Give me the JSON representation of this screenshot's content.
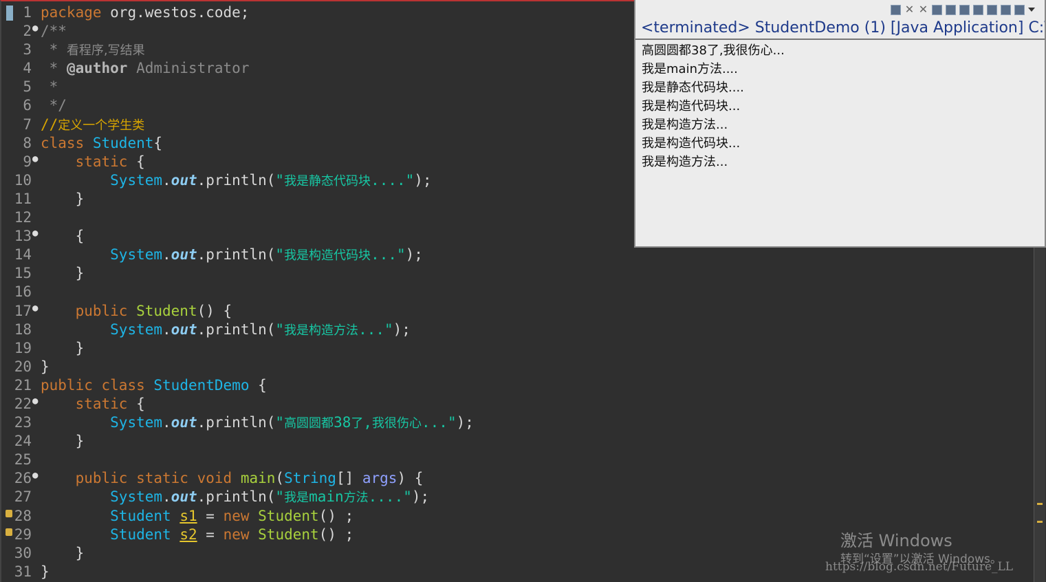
{
  "editor": {
    "lines": [
      {
        "n": "1",
        "fold": false,
        "warn": false,
        "html": "<span class=\"kw\">package</span> org.westos.code;"
      },
      {
        "n": "2",
        "fold": true,
        "warn": false,
        "html": "<span class=\"com\">/**</span>"
      },
      {
        "n": "3",
        "fold": false,
        "warn": false,
        "html": "<span class=\"com\"> * <span class=\"cn\">看程序,写结果</span></span>"
      },
      {
        "n": "4",
        "fold": false,
        "warn": false,
        "html": "<span class=\"com\"> * <span class=\"ann\">@author</span> Administrator</span>"
      },
      {
        "n": "5",
        "fold": false,
        "warn": false,
        "html": "<span class=\"com\"> *</span>"
      },
      {
        "n": "6",
        "fold": false,
        "warn": false,
        "html": "<span class=\"com\"> */</span>"
      },
      {
        "n": "7",
        "fold": false,
        "warn": false,
        "html": "<span class=\"lc\">//<span class=\"cn\">定义一个学生类</span></span>"
      },
      {
        "n": "8",
        "fold": false,
        "warn": false,
        "html": "<span class=\"kw\">class</span> <span class=\"cls\">Student</span>{"
      },
      {
        "n": "9",
        "fold": true,
        "warn": false,
        "html": "    <span class=\"kw\">static</span> {"
      },
      {
        "n": "10",
        "fold": false,
        "warn": false,
        "html": "        <span class=\"ty\">System</span>.<span class=\"fld\">out</span>.println(<span class=\"str\">\"<span class=\"cn\">我是静态代码块</span>....\"</span>);"
      },
      {
        "n": "11",
        "fold": false,
        "warn": false,
        "html": "    }"
      },
      {
        "n": "12",
        "fold": false,
        "warn": false,
        "html": ""
      },
      {
        "n": "13",
        "fold": true,
        "warn": false,
        "html": "    {"
      },
      {
        "n": "14",
        "fold": false,
        "warn": false,
        "html": "        <span class=\"ty\">System</span>.<span class=\"fld\">out</span>.println(<span class=\"str\">\"<span class=\"cn\">我是构造代码块</span>...\"</span>);"
      },
      {
        "n": "15",
        "fold": false,
        "warn": false,
        "html": "    }"
      },
      {
        "n": "16",
        "fold": false,
        "warn": false,
        "html": ""
      },
      {
        "n": "17",
        "fold": true,
        "warn": false,
        "html": "    <span class=\"kw\">public</span> <span class=\"fn\">Student</span>() {"
      },
      {
        "n": "18",
        "fold": false,
        "warn": false,
        "html": "        <span class=\"ty\">System</span>.<span class=\"fld\">out</span>.println(<span class=\"str\">\"<span class=\"cn\">我是构造方法</span>...\"</span>);"
      },
      {
        "n": "19",
        "fold": false,
        "warn": false,
        "html": "    }"
      },
      {
        "n": "20",
        "fold": false,
        "warn": false,
        "html": "}"
      },
      {
        "n": "21",
        "fold": false,
        "warn": false,
        "html": "<span class=\"kw\">public</span> <span class=\"kw\">class</span> <span class=\"cls\">StudentDemo</span> {"
      },
      {
        "n": "22",
        "fold": true,
        "warn": false,
        "html": "    <span class=\"kw\">static</span> {"
      },
      {
        "n": "23",
        "fold": false,
        "warn": false,
        "html": "        <span class=\"ty\">System</span>.<span class=\"fld\">out</span>.println(<span class=\"str\">\"<span class=\"cn\">高圆圆都</span>38<span class=\"cn\">了</span>,<span class=\"cn\">我很伤心</span>...\"</span>);"
      },
      {
        "n": "24",
        "fold": false,
        "warn": false,
        "html": "    }"
      },
      {
        "n": "25",
        "fold": false,
        "warn": false,
        "html": ""
      },
      {
        "n": "26",
        "fold": true,
        "warn": false,
        "html": "    <span class=\"kw\">public</span> <span class=\"kw\">static</span> <span class=\"kw\">void</span> <span class=\"fn\">main</span>(<span class=\"ty\">String</span>[] <span class=\"par\">args</span>) {"
      },
      {
        "n": "27",
        "fold": false,
        "warn": false,
        "html": "        <span class=\"ty\">System</span>.<span class=\"fld\">out</span>.println(<span class=\"str\">\"<span class=\"cn\">我是</span>main<span class=\"cn\">方法</span>....\"</span>);"
      },
      {
        "n": "28",
        "fold": false,
        "warn": true,
        "html": "        <span class=\"ty\">Student</span> <span class=\"var\">s1</span> = <span class=\"kw\">new</span> <span class=\"fn\">Student</span>() ;"
      },
      {
        "n": "29",
        "fold": false,
        "warn": true,
        "html": "        <span class=\"ty\">Student</span> <span class=\"var\">s2</span> = <span class=\"kw\">new</span> <span class=\"fn\">Student</span>() ;"
      },
      {
        "n": "30",
        "fold": false,
        "warn": false,
        "html": "    }"
      },
      {
        "n": "31",
        "fold": false,
        "warn": false,
        "html": "}"
      }
    ]
  },
  "console": {
    "title": "<terminated> StudentDemo (1) [Java Application] C:\\",
    "output": [
      "高圆圆都38了,我很伤心...",
      "我是main方法....",
      "我是静态代码块....",
      "我是构造代码块...",
      "我是构造方法...",
      "我是构造代码块...",
      "我是构造方法..."
    ],
    "toolbar_icons": [
      "terminate-icon",
      "remove-launch-icon",
      "remove-all-icon",
      "scroll-lock-icon",
      "word-wrap-icon",
      "show-on-output-icon",
      "show-on-error-icon",
      "pin-console-icon",
      "display-console-icon",
      "open-console-icon",
      "view-menu-icon"
    ]
  },
  "watermark": {
    "title": "激活 Windows",
    "subtitle": "转到“设置”以激活 Windows。",
    "credit": "https://blog.csdn.net/Future_LL"
  }
}
